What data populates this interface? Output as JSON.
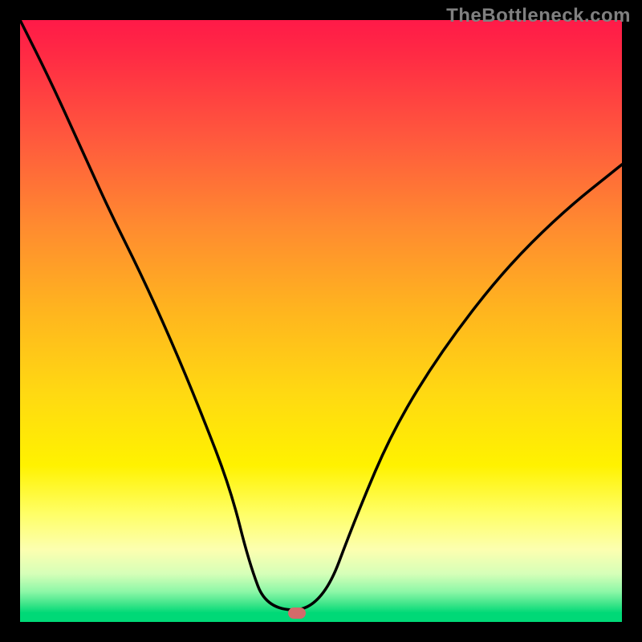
{
  "watermark": "TheBottleneck.com",
  "colors": {
    "frame_bg": "#000000",
    "watermark": "#808080",
    "curve": "#000000",
    "marker": "#d46a6a",
    "gradient_stops": [
      "#ff1a48",
      "#ff2b44",
      "#ff5a3d",
      "#ff8a30",
      "#ffb41f",
      "#ffd912",
      "#fff200",
      "#ffff66",
      "#fcffb0",
      "#d6ffb8",
      "#8cf7a7",
      "#3fe58a",
      "#00d977"
    ]
  },
  "chart_data": {
    "type": "line",
    "title": "",
    "xlabel": "",
    "ylabel": "",
    "xlim": [
      0,
      1
    ],
    "ylim": [
      0,
      1
    ],
    "series": [
      {
        "name": "curve",
        "x": [
          0.0,
          0.05,
          0.1,
          0.15,
          0.2,
          0.25,
          0.3,
          0.35,
          0.38,
          0.41,
          0.5,
          0.56,
          0.62,
          0.7,
          0.8,
          0.9,
          1.0
        ],
        "y": [
          1.0,
          0.9,
          0.79,
          0.68,
          0.58,
          0.47,
          0.35,
          0.22,
          0.1,
          0.02,
          0.02,
          0.18,
          0.32,
          0.45,
          0.58,
          0.68,
          0.76
        ]
      }
    ],
    "marker": {
      "x": 0.46,
      "y": 0.015
    },
    "notes": "V-shaped bottleneck curve over vertical red→green gradient; minimum near x≈0.41–0.50 at y≈0. Axes have no visible tick labels."
  }
}
